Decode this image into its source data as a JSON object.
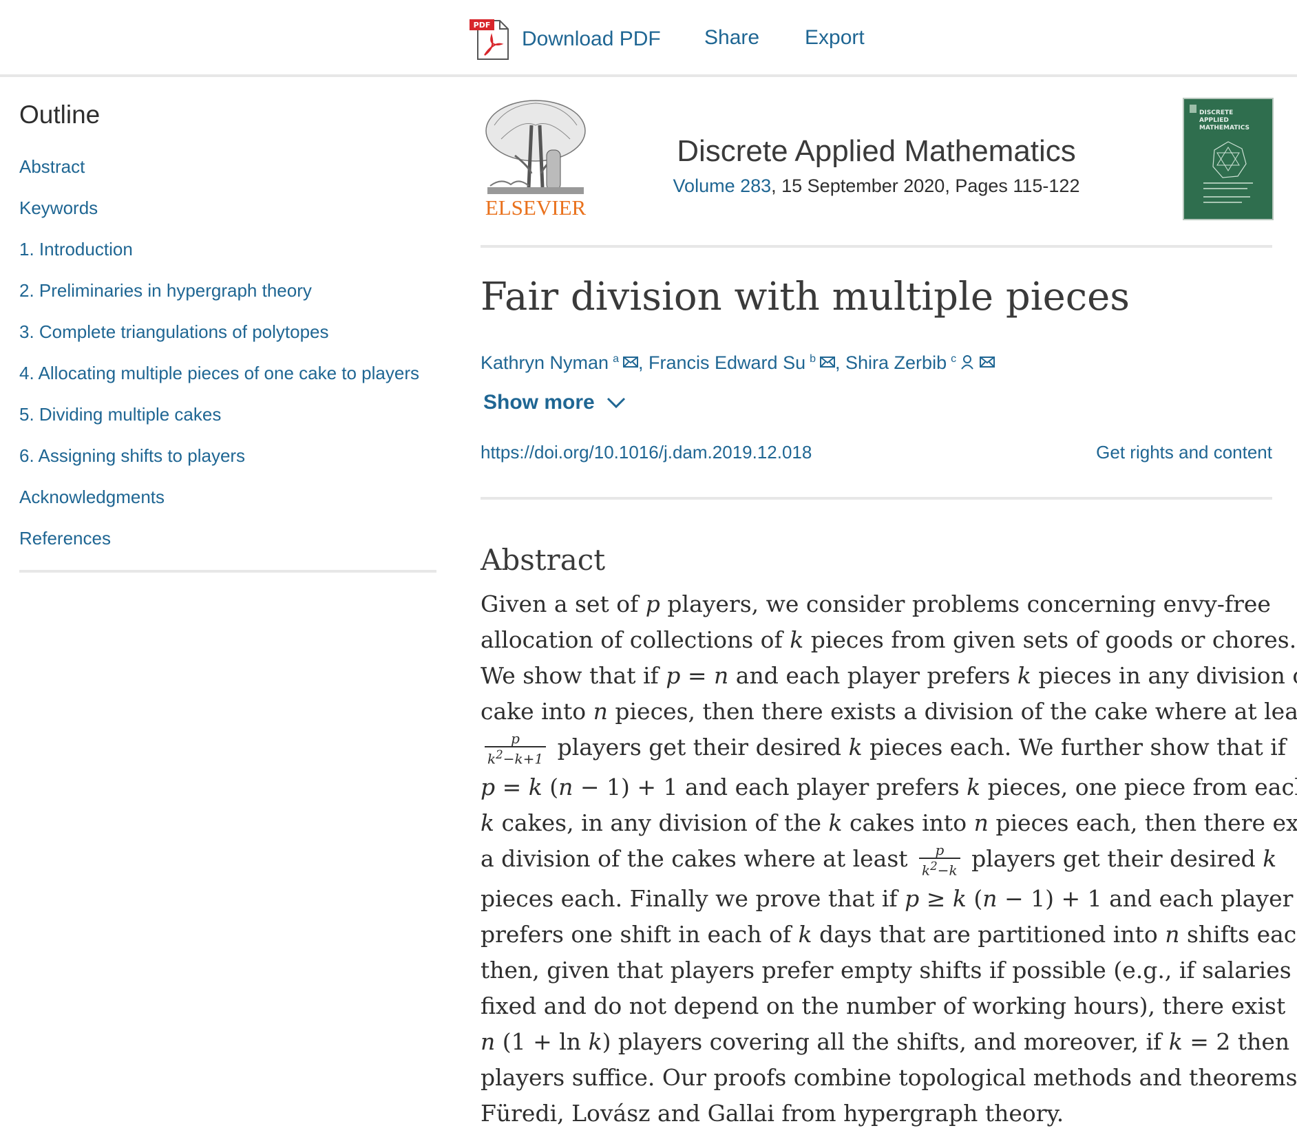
{
  "toolbar": {
    "pdf_icon": "pdf-file-icon",
    "download_pdf_label": "Download PDF",
    "share_label": "Share",
    "export_label": "Export"
  },
  "outline": {
    "title": "Outline",
    "items": [
      {
        "label": "Abstract"
      },
      {
        "label": "Keywords"
      },
      {
        "label": "1. Introduction"
      },
      {
        "label": "2. Preliminaries in hypergraph theory"
      },
      {
        "label": "3. Complete triangulations of polytopes"
      },
      {
        "label": "4. Allocating multiple pieces of one cake to players"
      },
      {
        "label": "5. Dividing multiple cakes"
      },
      {
        "label": "6. Assigning shifts to players"
      },
      {
        "label": "Acknowledgments"
      },
      {
        "label": "References"
      }
    ]
  },
  "publisher": {
    "name": "ELSEVIER",
    "logo_icon": "elsevier-tree-logo",
    "brand_color": "#e9711c"
  },
  "journal": {
    "title": "Discrete Applied Mathematics",
    "volume": "Volume 283",
    "issue_info": ", 15 September 2020, Pages 115-122",
    "cover_icon": "journal-cover-thumbnail",
    "cover_text": "DISCRETE APPLIED MATHEMATICS",
    "cover_color": "#2f6e4e"
  },
  "article": {
    "title": "Fair division with multiple pieces",
    "authors": [
      {
        "name": "Kathryn Nyman",
        "affiliation": "a",
        "icons": [
          "email-icon"
        ]
      },
      {
        "name": "Francis Edward Su",
        "affiliation": "b",
        "icons": [
          "email-icon"
        ]
      },
      {
        "name": "Shira Zerbib",
        "affiliation": "c",
        "icons": [
          "person-icon",
          "email-icon"
        ]
      }
    ],
    "author_separator": ", ",
    "show_more_label": "Show more",
    "doi": "https://doi.org/10.1016/j.dam.2019.12.018",
    "rights_label": "Get rights and content"
  },
  "abstract": {
    "heading": "Abstract",
    "text": "Given a set of p players, we consider problems concerning envy-free allocation of collections of k pieces from given sets of goods or chores. We show that if p = n and each player prefers k pieces in any division of a cake into n pieces, then there exists a division of the cake where at least p/(k²−k+1) players get their desired k pieces each. We further show that if p = k(n − 1) + 1 and each player prefers k pieces, one piece from each of k cakes, in any division of the k cakes into n pieces each, then there exists a division of the cakes where at least p/(k²−k) players get their desired k pieces each. Finally we prove that if p ≥ k(n − 1) + 1 and each player prefers one shift in each of k days that are partitioned into n shifts each, then, given that players prefer empty shifts if possible (e.g., if salaries are fixed and do not depend on the number of working hours), there exist n(1 + ln k) players covering all the shifts, and moreover, if k = 2 then n players suffice. Our proofs combine topological methods and theorems of Füredi, Lovász and Gallai from hypergraph theory."
  },
  "colors": {
    "link": "#1f6693",
    "text": "#2e2e2e",
    "rule": "#e7e7e7",
    "pdf_red": "#d8262b"
  }
}
